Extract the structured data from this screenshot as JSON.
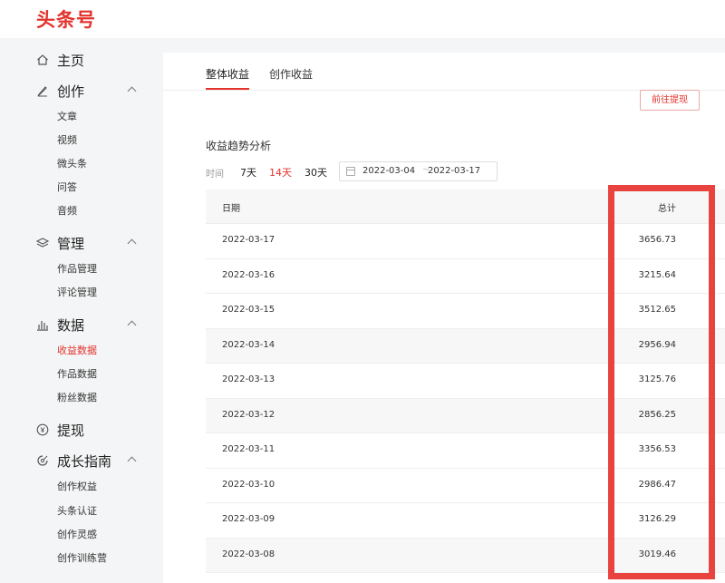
{
  "header": {
    "logo": "头条号"
  },
  "sidebar": {
    "groups": [
      {
        "label": "主页",
        "icon": "home-icon",
        "items": []
      },
      {
        "label": "创作",
        "icon": "pen-icon",
        "items": [
          "文章",
          "视频",
          "微头条",
          "问答",
          "音频"
        ]
      },
      {
        "label": "管理",
        "icon": "layers-icon",
        "items": [
          "作品管理",
          "评论管理"
        ]
      },
      {
        "label": "数据",
        "icon": "bar-chart-icon",
        "items": [
          "收益数据",
          "作品数据",
          "粉丝数据"
        ],
        "active_item": "收益数据"
      },
      {
        "label": "提现",
        "icon": "yen-coin-icon",
        "items": []
      },
      {
        "label": "成长指南",
        "icon": "growth-icon",
        "items": [
          "创作权益",
          "头条认证",
          "创作灵感",
          "创作训练营"
        ]
      }
    ]
  },
  "main": {
    "tabs": [
      "整体收益",
      "创作收益"
    ],
    "active_tab": "整体收益",
    "withdraw_button": "前往提现",
    "section_title": "收益趋势分析",
    "filter": {
      "label": "时间",
      "options": [
        "7天",
        "14天",
        "30天"
      ],
      "active_option": "14天",
      "date_start": "2022-03-04",
      "date_sep": "~",
      "date_end": "2022-03-17"
    },
    "table": {
      "columns": [
        "日期",
        "总计"
      ],
      "rows": [
        {
          "date": "2022-03-17",
          "total": "3656.73"
        },
        {
          "date": "2022-03-16",
          "total": "3215.64"
        },
        {
          "date": "2022-03-15",
          "total": "3512.65"
        },
        {
          "date": "2022-03-14",
          "total": "2956.94"
        },
        {
          "date": "2022-03-13",
          "total": "3125.76"
        },
        {
          "date": "2022-03-12",
          "total": "2856.25"
        },
        {
          "date": "2022-03-11",
          "total": "3356.53"
        },
        {
          "date": "2022-03-10",
          "total": "2986.47"
        },
        {
          "date": "2022-03-09",
          "total": "3126.29"
        },
        {
          "date": "2022-03-08",
          "total": "3019.46"
        }
      ]
    }
  },
  "colors": {
    "accent": "#e2332c",
    "highlight": "#e8433f",
    "sidebar_bg": "#f4f5f6"
  }
}
